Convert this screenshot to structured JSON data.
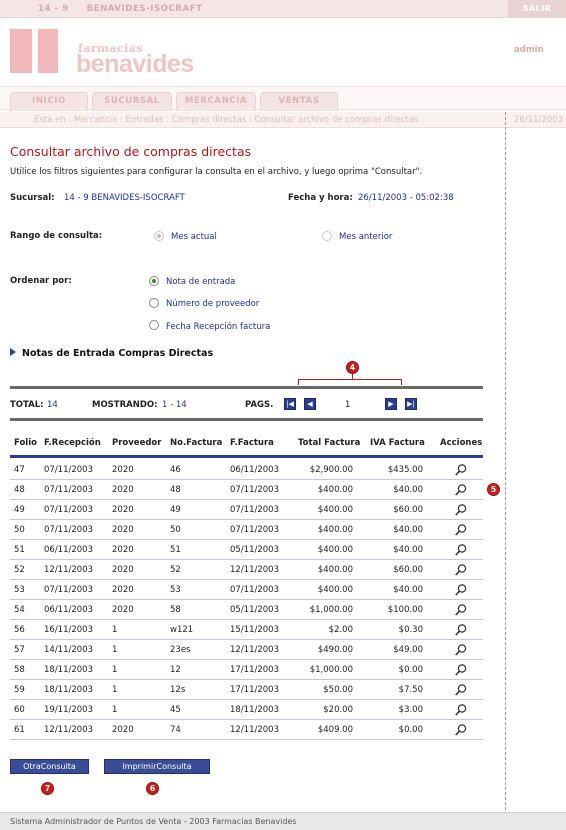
{
  "topbar": {
    "store": "14 - 9     BENAVIDES-ISOCRAFT",
    "salir": "SALIR"
  },
  "header": {
    "logo_small": "farmacias",
    "logo_big": "benavides",
    "user": "admin"
  },
  "tabs": [
    "INICIO",
    "SUCURSAL",
    "MERCANCÍA",
    "VENTAS"
  ],
  "breadcrumb": {
    "path": "Esta en : Mercancia : Entradas : Compras directas : Consultar archivo de compras directas",
    "date": "26/11/2003"
  },
  "page": {
    "title": "Consultar archivo de compras directas",
    "intro": "Utilice los filtros siguientes para configurar la consulta en el archivo, y luego oprima \"Consultar\".",
    "sucursal_label": "Sucursal:",
    "sucursal_value": "14 - 9   BENAVIDES-ISOCRAFT",
    "fecha_label": "Fecha y hora:",
    "fecha_value": "26/11/2003 - 05:02:38",
    "rango_label": "Rango de consulta:",
    "rango_options": [
      "Mes actual",
      "Mes anterior"
    ],
    "rango_selected": "Mes actual",
    "ordenar_label": "Ordenar por:",
    "ordenar_options": [
      "Nota de entrada",
      "Número de proveedor",
      "Fecha Recepción factura"
    ],
    "ordenar_selected": "Nota de entrada",
    "section_title": "Notas de Entrada Compras Directas"
  },
  "pagination": {
    "total_label": "TOTAL:",
    "total_value": "14",
    "mostrando_label": "MOSTRANDO:",
    "mostrando_value": "1 - 14",
    "pags_label": "PAGS.",
    "current_page": "1"
  },
  "table": {
    "columns": [
      "Folio",
      "F.Recepción",
      "Proveedor",
      "No.Factura",
      "F.Factura",
      "Total Factura",
      "IVA Factura",
      "Acciones"
    ],
    "rows": [
      [
        "47",
        "07/11/2003",
        "2020",
        "46",
        "06/11/2003",
        "$2,900.00",
        "$435.00"
      ],
      [
        "48",
        "07/11/2003",
        "2020",
        "48",
        "07/11/2003",
        "$400.00",
        "$40.00"
      ],
      [
        "49",
        "07/11/2003",
        "2020",
        "49",
        "07/11/2003",
        "$400.00",
        "$60.00"
      ],
      [
        "50",
        "07/11/2003",
        "2020",
        "50",
        "07/11/2003",
        "$400.00",
        "$40.00"
      ],
      [
        "51",
        "06/11/2003",
        "2020",
        "51",
        "05/11/2003",
        "$400.00",
        "$40.00"
      ],
      [
        "52",
        "12/11/2003",
        "2020",
        "52",
        "12/11/2003",
        "$400.00",
        "$60.00"
      ],
      [
        "53",
        "07/11/2003",
        "2020",
        "53",
        "07/11/2003",
        "$400.00",
        "$40.00"
      ],
      [
        "54",
        "06/11/2003",
        "2020",
        "58",
        "05/11/2003",
        "$1,000.00",
        "$100.00"
      ],
      [
        "56",
        "16/11/2003",
        "1",
        "w121",
        "15/11/2003",
        "$2.00",
        "$0.30"
      ],
      [
        "57",
        "14/11/2003",
        "1",
        "23es",
        "12/11/2003",
        "$490.00",
        "$49.00"
      ],
      [
        "58",
        "18/11/2003",
        "1",
        "12",
        "17/11/2003",
        "$1,000.00",
        "$0.00"
      ],
      [
        "59",
        "18/11/2003",
        "1",
        "12s",
        "17/11/2003",
        "$50.00",
        "$7.50"
      ],
      [
        "60",
        "19/11/2003",
        "1",
        "45",
        "18/11/2003",
        "$20.00",
        "$3.00"
      ],
      [
        "61",
        "12/11/2003",
        "2020",
        "74",
        "12/11/2003",
        "$409.00",
        "$0.00"
      ]
    ]
  },
  "buttons": {
    "otra": "OtraConsulta",
    "imprimir": "ImprimirConsulta"
  },
  "callouts": {
    "pagination": "4",
    "row_action": "5",
    "imprimir": "6",
    "otra": "7"
  },
  "footer": "Sistema Administrador de Puntos de Venta - 2003 Farmacias Benavides",
  "colors": {
    "title_red": "#b01818",
    "link_blue": "#1d2ea0",
    "button_blue": "#3a4c96",
    "callout_red": "#c52020"
  },
  "icons": {
    "row_action": "magnifier-icon",
    "first": "first-page-icon",
    "prev": "prev-page-icon",
    "next": "next-page-icon",
    "last": "last-page-icon"
  }
}
